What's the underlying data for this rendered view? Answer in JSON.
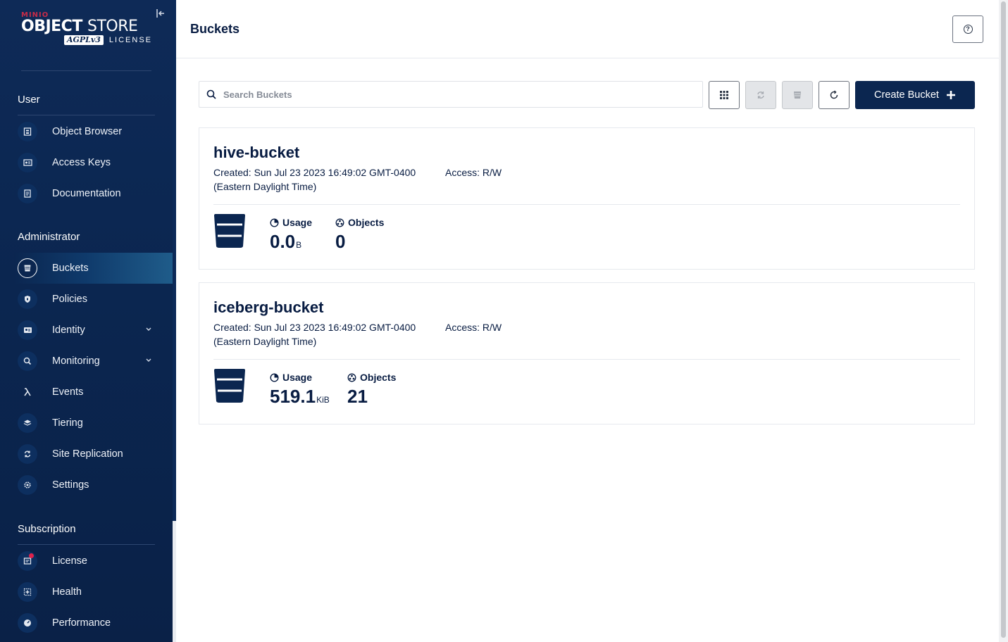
{
  "brand": {
    "minio": "MINIO",
    "product_bold": "OBJECT",
    "product_light": "STORE",
    "badge": "AGPLv3",
    "license": "LICENSE"
  },
  "sidebar": {
    "sections": {
      "user": "User",
      "administrator": "Administrator",
      "subscription": "Subscription"
    },
    "user_items": [
      {
        "label": "Object Browser",
        "icon": "object-browser-icon"
      },
      {
        "label": "Access Keys",
        "icon": "access-keys-icon"
      },
      {
        "label": "Documentation",
        "icon": "documentation-icon"
      }
    ],
    "admin_items": [
      {
        "label": "Buckets",
        "icon": "bucket-icon",
        "active": true
      },
      {
        "label": "Policies",
        "icon": "shield-icon"
      },
      {
        "label": "Identity",
        "icon": "identity-icon",
        "expandable": true
      },
      {
        "label": "Monitoring",
        "icon": "monitoring-icon",
        "expandable": true
      },
      {
        "label": "Events",
        "icon": "lambda-icon"
      },
      {
        "label": "Tiering",
        "icon": "layers-icon"
      },
      {
        "label": "Site Replication",
        "icon": "replication-icon"
      },
      {
        "label": "Settings",
        "icon": "gear-icon"
      }
    ],
    "subscription_items": [
      {
        "label": "License",
        "icon": "license-icon",
        "badge": true
      },
      {
        "label": "Health",
        "icon": "health-icon"
      },
      {
        "label": "Performance",
        "icon": "performance-icon"
      }
    ]
  },
  "header": {
    "title": "Buckets"
  },
  "toolbar": {
    "search_placeholder": "Search Buckets",
    "create_label": "Create Bucket"
  },
  "buckets": [
    {
      "name": "hive-bucket",
      "created": "Created: Sun Jul 23 2023 16:49:02 GMT-0400 (Eastern Daylight Time)",
      "access": "Access: R/W",
      "usage_label": "Usage",
      "usage_value": "0.0",
      "usage_unit": "B",
      "objects_label": "Objects",
      "objects_value": "0"
    },
    {
      "name": "iceberg-bucket",
      "created": "Created: Sun Jul 23 2023 16:49:02 GMT-0400 (Eastern Daylight Time)",
      "access": "Access: R/W",
      "usage_label": "Usage",
      "usage_value": "519.1",
      "usage_unit": "KiB",
      "objects_label": "Objects",
      "objects_value": "21"
    }
  ],
  "colors": {
    "sidebar_bg": "#0b2650",
    "primary": "#0b2650",
    "text": "#081c42",
    "badge": "#e0224b"
  }
}
